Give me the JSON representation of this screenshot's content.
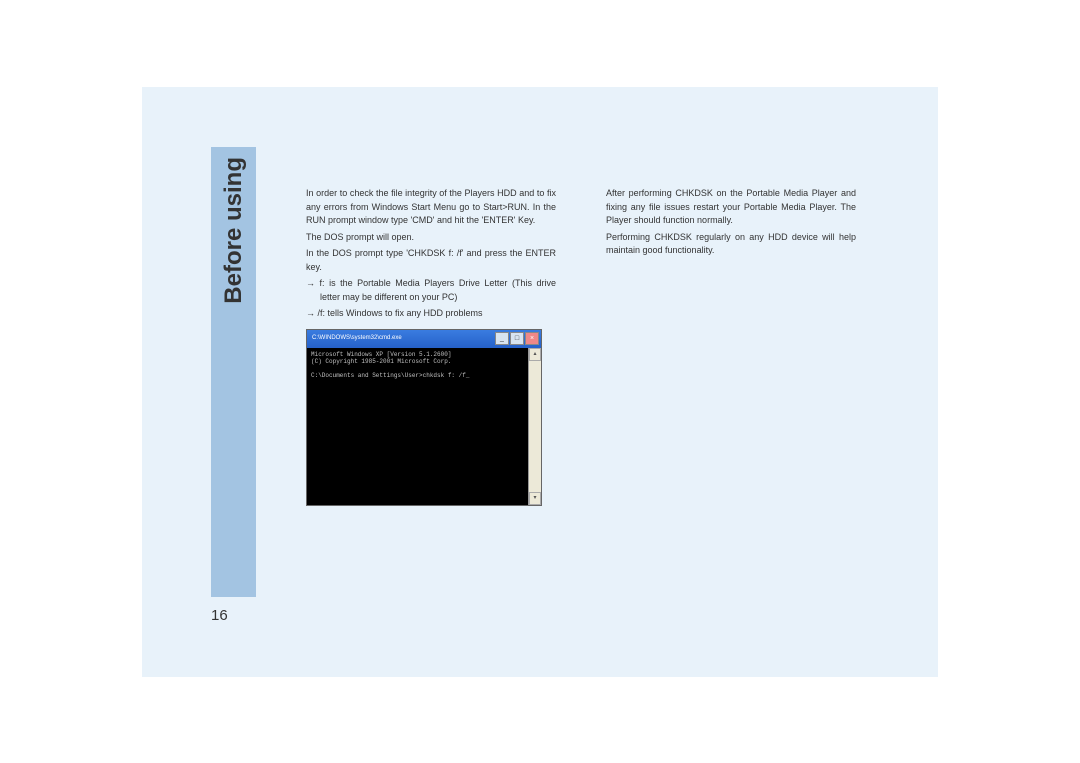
{
  "sidebar": {
    "title": "Before using"
  },
  "pageNumber": "16",
  "leftColumn": {
    "p1": "In order to check the file integrity of the Players HDD and to fix any errors from Windows Start Menu go to Start>RUN. In the RUN prompt window type 'CMD' and hit the 'ENTER' Key.",
    "p2": "The DOS prompt will open.",
    "p3": "In the DOS prompt type 'CHKDSK f: /f' and press the ENTER key.",
    "p4": "→ f: is the Portable Media Players Drive Letter (This drive letter may be different on your PC)",
    "p5": "→ /f: tells Windows to fix any HDD problems"
  },
  "rightColumn": {
    "p1": "After performing CHKDSK on the Portable Media Player and fixing any file issues restart your Portable Media Player. The Player should function normally.",
    "p2": "Performing CHKDSK regularly on any HDD device will help maintain good functionality."
  },
  "cmdWindow": {
    "title": "C:\\WINDOWS\\system32\\cmd.exe",
    "line1": "Microsoft Windows XP [Version 5.1.2600]",
    "line2": "(C) Copyright 1985-2001 Microsoft Corp.",
    "line3": "C:\\Documents and Settings\\User>chkdsk f: /f_"
  }
}
